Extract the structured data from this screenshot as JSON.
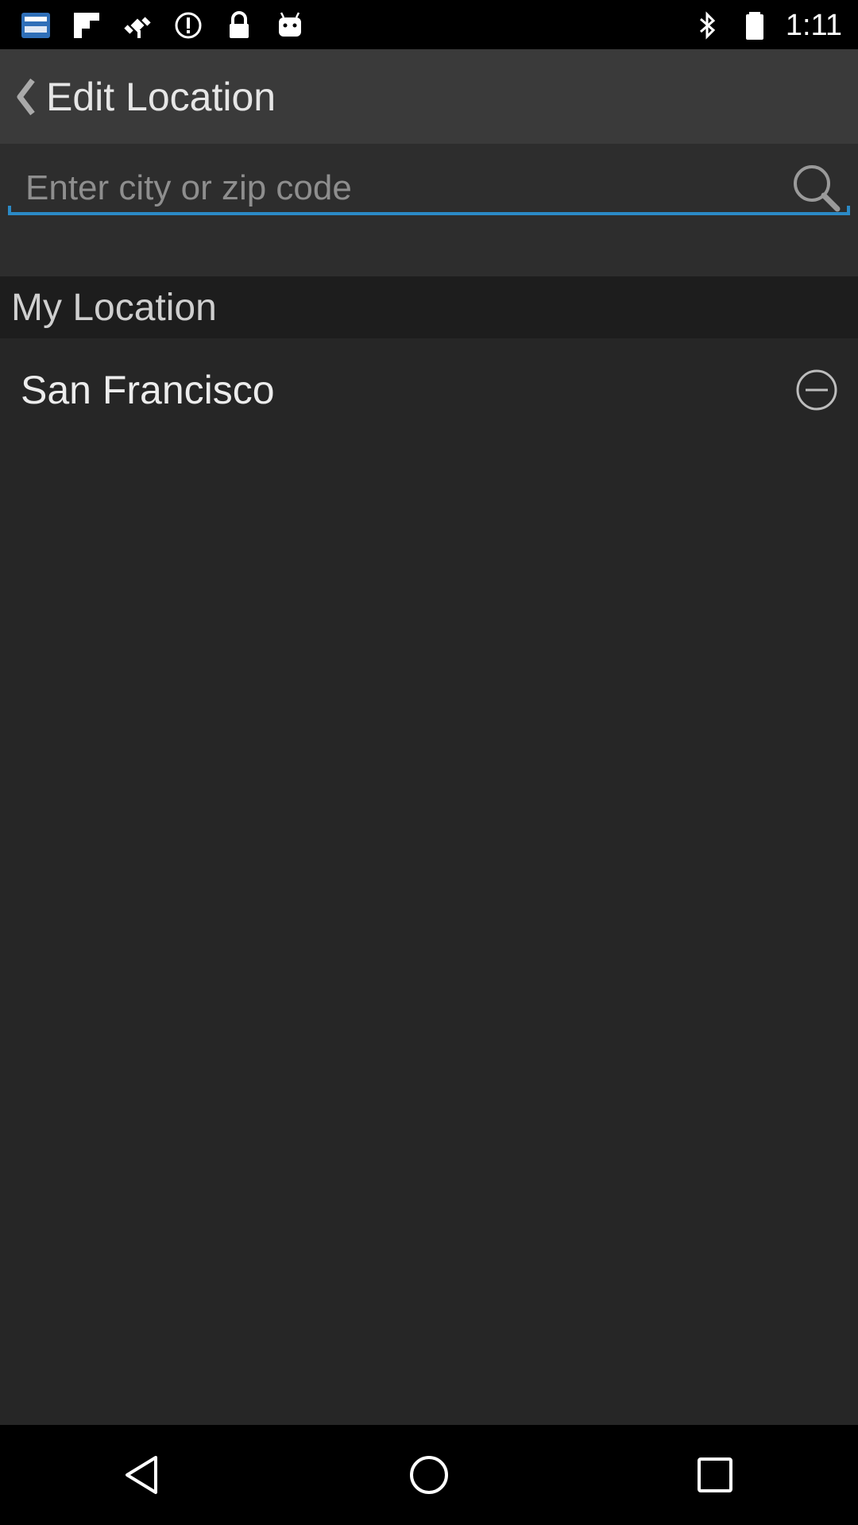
{
  "status_bar": {
    "time": "1:11",
    "icons": [
      "keyboard-language-icon",
      "flipboard-icon",
      "fake-gps-icon",
      "alert-icon",
      "lock-icon",
      "android-debug-icon",
      "bluetooth-icon"
    ]
  },
  "action_bar": {
    "title": "Edit Location"
  },
  "search": {
    "placeholder": "Enter city or zip code",
    "value": "",
    "accent_color": "#2b8ac6"
  },
  "my_location": {
    "header": "My Location",
    "items": [
      {
        "label": "San Francisco"
      }
    ]
  },
  "nav_bar": {
    "buttons": [
      "back-nav-icon",
      "home-nav-icon",
      "recents-nav-icon"
    ]
  }
}
